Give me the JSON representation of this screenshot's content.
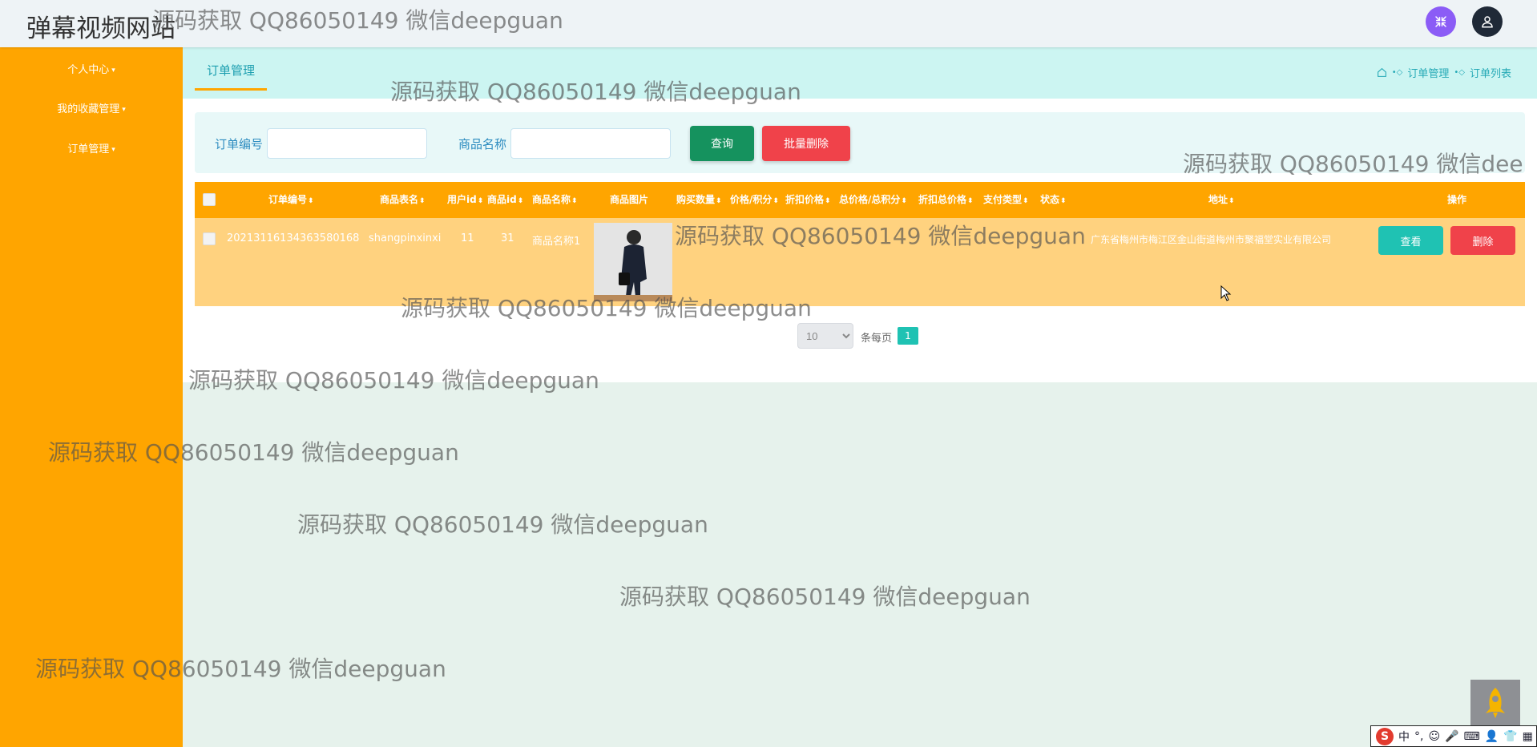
{
  "header": {
    "app_title": "弹幕视频网站",
    "fullscreen_icon": "shrink-arrows-icon",
    "user_icon": "user-icon",
    "accent_purple": "#8b5cf6"
  },
  "sidebar": {
    "color": "#ffa500",
    "items": [
      {
        "label": "个人中心"
      },
      {
        "label": "我的收藏管理"
      },
      {
        "label": "订单管理"
      }
    ]
  },
  "tab": {
    "label": "订单管理"
  },
  "breadcrumb": {
    "home_icon": "home-icon",
    "items": [
      "订单管理",
      "订单列表"
    ]
  },
  "search": {
    "order_no_label": "订单编号",
    "order_no_value": "",
    "product_name_label": "商品名称",
    "product_name_value": "",
    "query_button": "查询",
    "batch_delete_button": "批量删除"
  },
  "table": {
    "columns": [
      "订单编号",
      "商品表名",
      "用户id",
      "商品id",
      "商品名称",
      "商品图片",
      "购买数量",
      "价格/积分",
      "折扣价格",
      "总价格/总积分",
      "折扣总价格",
      "支付类型",
      "状态",
      "地址",
      "操作"
    ],
    "rows": [
      {
        "order_no": "20213116134363580168",
        "table_name": "shangpinxinxi",
        "user_id": "11",
        "product_id": "31",
        "product_name": "商品名称1",
        "address": "广东省梅州市梅江区金山街道梅州市聚福堂实业有限公司",
        "view_button": "查看",
        "delete_button": "删除"
      }
    ]
  },
  "pager": {
    "page_size": "10",
    "per_page_label": "条每页",
    "current_page": "1"
  },
  "watermark": "源码获取 QQ86050149 微信deepguan",
  "watermark_clipped": "源码获取 QQ86050149 微信dee",
  "ime": {
    "logo": "S",
    "mode": "中"
  }
}
